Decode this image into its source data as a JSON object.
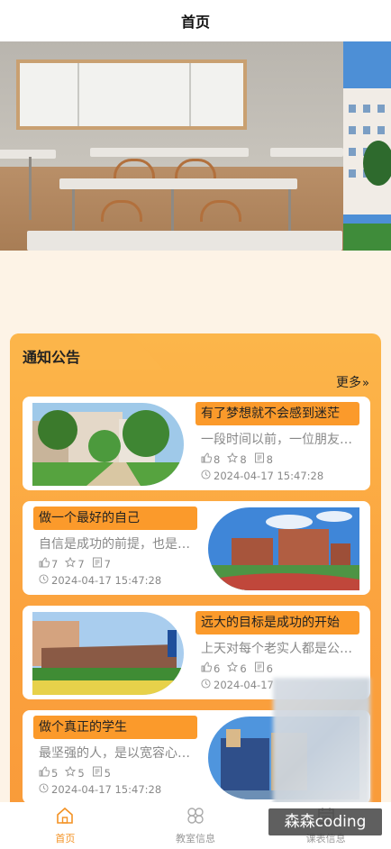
{
  "header": {
    "title": "首页"
  },
  "notices": {
    "section_title": "通知公告",
    "more_label": "更多",
    "more_chevron": "»",
    "items": [
      {
        "title": "有了梦想就不会感到迷茫",
        "desc": "一段时间以前，一位朋友问我",
        "likes": "8",
        "favorites": "8",
        "comments": "8",
        "time": "2024-04-17 15:47:28",
        "thumb": "school-garden-photo"
      },
      {
        "title": "做一个最好的自己",
        "desc": "自信是成功的前提，也是一种",
        "likes": "7",
        "favorites": "7",
        "comments": "7",
        "time": "2024-04-17 15:47:28",
        "thumb": "school-building-photo"
      },
      {
        "title": "远大的目标是成功的开始",
        "desc": "上天对每个老实人都是公平的",
        "likes": "6",
        "favorites": "6",
        "comments": "6",
        "time": "2024-04-17",
        "thumb": "school-gate-photo"
      },
      {
        "title": "做个真正的学生",
        "desc": "最坚强的人，是以宽容心待人",
        "likes": "5",
        "favorites": "5",
        "comments": "5",
        "time": "2024-04-17 15:47:28",
        "thumb": "campus-tower-photo"
      }
    ]
  },
  "tabbar": {
    "items": [
      {
        "label": "首页",
        "icon": "home-icon",
        "active": true
      },
      {
        "label": "教室信息",
        "icon": "grid-icon",
        "active": false
      },
      {
        "label": "课表信息",
        "icon": "calendar-icon",
        "active": false
      }
    ]
  },
  "watermark": {
    "text": "森森coding"
  },
  "colors": {
    "accent": "#fb9a2b",
    "tab_active": "#f39224",
    "background": "#fdf3e6"
  }
}
